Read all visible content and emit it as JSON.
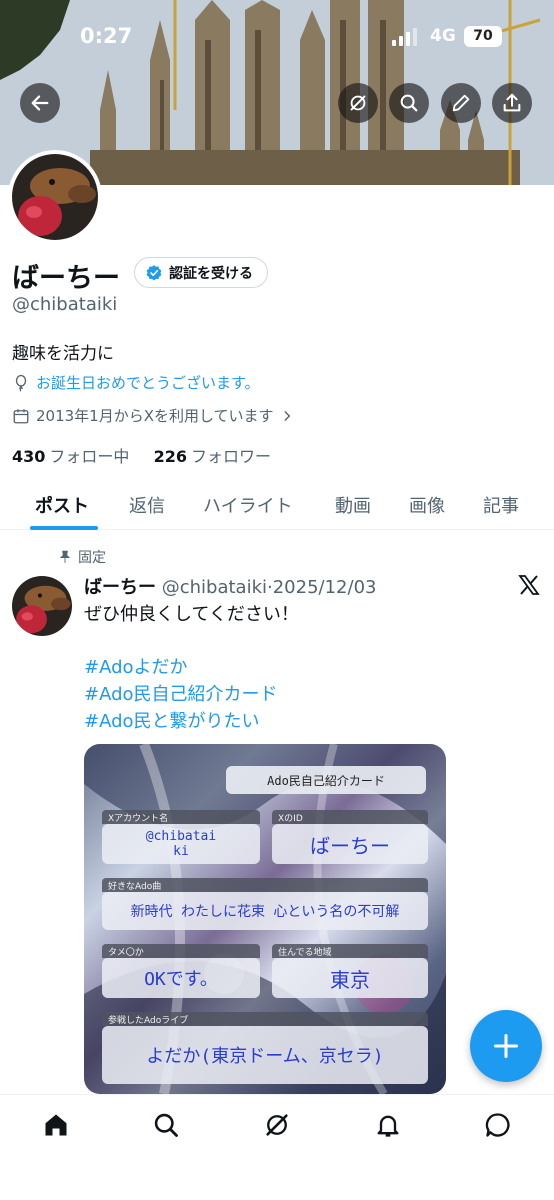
{
  "status_bar": {
    "time": "0:27",
    "network": "4G",
    "battery": "70"
  },
  "profile": {
    "display_name": "ばーちー",
    "verify_label": "認証を受ける",
    "handle": "@chibataiki",
    "bio": "趣味を活力に",
    "birthday": "お誕生日おめでとうございます。",
    "joined": "2013年1月からXを利用しています",
    "following_count": "430",
    "following_label": "フォロー中",
    "followers_count": "226",
    "followers_label": "フォロワー"
  },
  "tabs": [
    "ポスト",
    "返信",
    "ハイライト",
    "動画",
    "画像",
    "記事"
  ],
  "pinned_post": {
    "pinned_label": "固定",
    "name": "ばーちー",
    "handle_date": "@chibataiki·2025/12/03",
    "text": "ぜひ仲良くしてください！",
    "hashtags": [
      "#Adoよだか",
      "#Ado民自己紹介カード",
      "#Ado民と繋がりたい"
    ],
    "card": {
      "title": "Ado民自己紹介カード",
      "account_label": "Xアカウント名",
      "account_value": "@chibatai ki",
      "id_label": "XのID",
      "id_value": "ばーちー",
      "song_label": "好きなAdo曲",
      "song_value": "新時代 わたしに花束 心という名の不可解",
      "tame_label": "タメ〇か",
      "tame_value": "OKです。",
      "area_label": "住んでる地域",
      "area_value": "東京",
      "live_label": "参戦したAdoライブ",
      "live_value": "よだか(東京ドーム、京セラ)"
    }
  },
  "colors": {
    "accent": "#1d9bf0",
    "text": "#0f1419",
    "muted": "#536471"
  },
  "icons": {
    "back": "arrow-left-icon",
    "grok": "grok-icon",
    "search": "search-icon",
    "edit": "pencil-icon",
    "share": "share-icon",
    "fab": "plus-icon",
    "nav": [
      "home-icon",
      "search-icon",
      "grok-icon",
      "bell-icon",
      "message-icon"
    ]
  }
}
